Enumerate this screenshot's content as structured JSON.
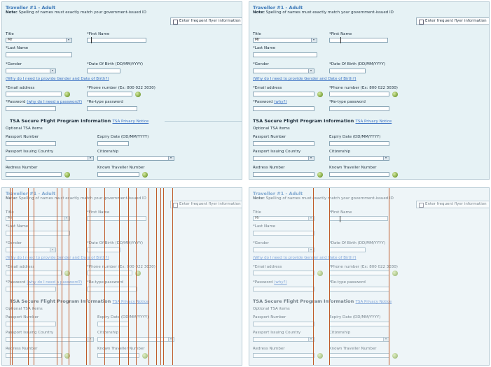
{
  "form": {
    "traveller_title": "Traveller #1 - Adult",
    "note_label": "Note:",
    "note_text": "Spelling of names must exactly match your government-issued ID",
    "frequent_flyer": "Enter frequent flyer information",
    "labels": {
      "title": "Title",
      "first_name": "*First Name",
      "last_name": "*Last Name",
      "gender": "*Gender",
      "dob": "*Date Of Birth (DD/MM/YYYY)",
      "why_gender": "(Why do I need to provide Gender and Date of Birth?)",
      "email": "*Email address",
      "phone": "*Phone number (Ex: 800 022 3030)",
      "password": "*Password",
      "why_password_long": "(why do I need a password?)",
      "why_password_short": "(why?)",
      "retype": "*Re-type password"
    },
    "title_value": "Mr",
    "tsa": {
      "heading": "TSA Secure Flight Program Information",
      "privacy": "TSA Privacy Notice",
      "optional": "Optional TSA items",
      "passport_number": "Passport Number",
      "expiry": "Expiry Date (DD/MM/YYYY)",
      "issuing_country": "Passport Issuing Country",
      "citizenship": "Citizenship",
      "redress": "Redress Number",
      "known_traveller": "Known Traveller Number"
    }
  },
  "colors": {
    "panel_bg": "#e6f2f5",
    "heading": "#3d79b8",
    "link": "#3c72c4",
    "overlay_line": "#bf5a2a"
  }
}
